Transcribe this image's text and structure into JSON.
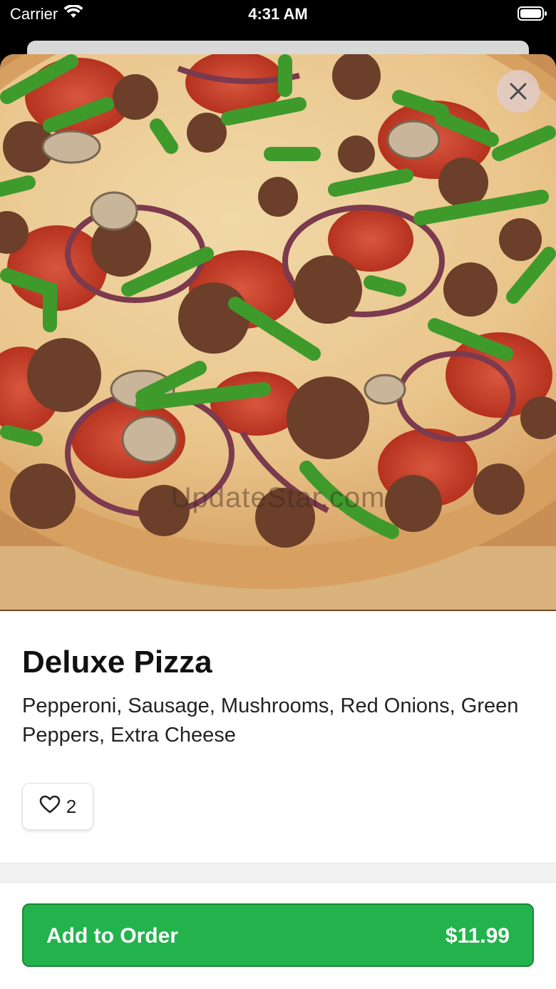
{
  "status_bar": {
    "carrier": "Carrier",
    "time": "4:31 AM",
    "wifi_icon": "wifi-icon",
    "battery_icon": "battery-icon"
  },
  "item": {
    "image_alt": "pizza-photo",
    "watermark": "UpdateStar.com",
    "name": "Deluxe Pizza",
    "description": "Pepperoni, Sausage, Mushrooms, Red Onions, Green Peppers, Extra Cheese",
    "likes": "2"
  },
  "actions": {
    "close_icon": "close-icon",
    "heart_icon": "heart-icon",
    "add_label": "Add to Order",
    "price": "$11.99"
  },
  "colors": {
    "accent_green": "#23b24c",
    "sheet_bg": "#ffffff",
    "status_bg": "#000000"
  }
}
